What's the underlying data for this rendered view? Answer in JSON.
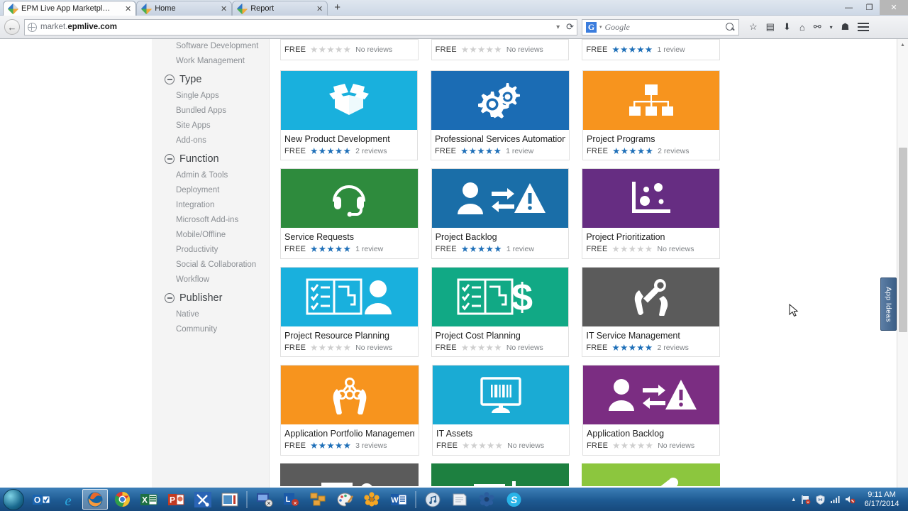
{
  "window": {
    "controls": {
      "minimize": "—",
      "maximize": "❐",
      "close": "✕"
    }
  },
  "browser": {
    "tabs": [
      {
        "title": "EPM Live App Marketplace",
        "close": "✕",
        "active": true
      },
      {
        "title": "Home",
        "close": "✕",
        "active": false
      },
      {
        "title": "Report",
        "close": "✕",
        "active": false
      }
    ],
    "new_tab_label": "+",
    "back_glyph": "←",
    "url_prefix": "market.",
    "url_bold": "epmlive.com",
    "reload_glyph": "⟳",
    "dropdown_glyph": "▾",
    "search_engine": "Google",
    "search_placeholder": "Google",
    "search_engine_letter": "G",
    "toolbar_icons": [
      "bookmark-star-icon",
      "reading-list-icon",
      "downloads-icon",
      "home-icon",
      "sync-icon",
      "chevron-down-icon",
      "firefox-hello-icon",
      "menu-icon"
    ]
  },
  "sidebar": {
    "orphan_items": [
      "Software Development",
      "Work Management"
    ],
    "groups": [
      {
        "title": "Type",
        "toggle": "collapse-icon",
        "items": [
          "Single Apps",
          "Bundled Apps",
          "Site Apps",
          "Add-ons"
        ]
      },
      {
        "title": "Function",
        "toggle": "collapse-icon",
        "items": [
          "Admin & Tools",
          "Deployment",
          "Integration",
          "Microsoft Add-ins",
          "Mobile/Offline",
          "Productivity",
          "Social & Collaboration",
          "Workflow"
        ]
      },
      {
        "title": "Publisher",
        "toggle": "collapse-icon",
        "items": [
          "Native",
          "Community"
        ]
      }
    ]
  },
  "marketplace": {
    "price_label": "FREE",
    "no_reviews_label": "No reviews",
    "cut_row": [
      {
        "price": "FREE",
        "rating": 0,
        "reviews": "No reviews"
      },
      {
        "price": "FREE",
        "rating": 0,
        "reviews": "No reviews"
      },
      {
        "price": "FREE",
        "rating": 5,
        "reviews": "1 review"
      }
    ],
    "apps": [
      {
        "name": "New Product Development",
        "price": "FREE",
        "rating": 5,
        "reviews": "2 reviews",
        "color": "#19b0dd",
        "icon": "open-box-icon"
      },
      {
        "name": "Professional Services Automation",
        "price": "FREE",
        "rating": 5,
        "reviews": "1 review",
        "color": "#1b6cb4",
        "icon": "gears-icon"
      },
      {
        "name": "Project Programs",
        "price": "FREE",
        "rating": 5,
        "reviews": "2 reviews",
        "color": "#f7941e",
        "icon": "org-chart-icon"
      },
      {
        "name": "Service Requests",
        "price": "FREE",
        "rating": 5,
        "reviews": "1 review",
        "color": "#2e8b3d",
        "icon": "headset-icon"
      },
      {
        "name": "Project Backlog",
        "price": "FREE",
        "rating": 5,
        "reviews": "1 review",
        "color": "#1a6ea8",
        "icon": "person-exchange-alert-icon"
      },
      {
        "name": "Project Prioritization",
        "price": "FREE",
        "rating": 0,
        "reviews": "No reviews",
        "color": "#662d82",
        "icon": "bubble-chart-icon"
      },
      {
        "name": "Project Resource Planning",
        "price": "FREE",
        "rating": 0,
        "reviews": "No reviews",
        "color": "#19b0dd",
        "icon": "checklist-gantt-person-icon"
      },
      {
        "name": "Project Cost Planning",
        "price": "FREE",
        "rating": 0,
        "reviews": "No reviews",
        "color": "#11a985",
        "icon": "checklist-gantt-dollar-icon"
      },
      {
        "name": "IT Service Management",
        "price": "FREE",
        "rating": 5,
        "reviews": "2 reviews",
        "color": "#5b5b5b",
        "icon": "hands-wrench-icon"
      },
      {
        "name": "Application Portfolio Management",
        "price": "FREE",
        "rating": 5,
        "reviews": "3 reviews",
        "color": "#f7941e",
        "icon": "hands-network-icon"
      },
      {
        "name": "IT Assets",
        "price": "FREE",
        "rating": 0,
        "reviews": "No reviews",
        "color": "#1aabd4",
        "icon": "monitor-barcode-icon"
      },
      {
        "name": "Application Backlog",
        "price": "FREE",
        "rating": 0,
        "reviews": "No reviews",
        "color": "#7b2d82",
        "icon": "person-exchange-alert-icon"
      }
    ],
    "partial_row_colors": [
      "#5b5b5b",
      "#1d8040",
      "#8cc63e"
    ],
    "app_ideas_tab": "App Ideas"
  },
  "taskbar": {
    "start": "start-orb",
    "items": [
      {
        "name": "outlook-icon",
        "active": false
      },
      {
        "name": "internet-explorer-icon",
        "active": false
      },
      {
        "name": "firefox-icon",
        "active": true
      },
      {
        "name": "chrome-icon",
        "active": false
      },
      {
        "name": "excel-icon",
        "active": false
      },
      {
        "name": "powerpoint-icon",
        "active": false
      },
      {
        "name": "tools-icon",
        "active": false
      },
      {
        "name": "media-player-icon",
        "active": false
      },
      {
        "name": "remote-desktop-icon",
        "active": false
      },
      {
        "name": "lync-icon",
        "active": false
      },
      {
        "name": "visio-icon",
        "active": false
      },
      {
        "name": "paint-icon",
        "active": false
      },
      {
        "name": "flower-app-icon",
        "active": false
      },
      {
        "name": "word-icon",
        "active": false
      },
      {
        "name": "itunes-icon",
        "active": false
      },
      {
        "name": "notepad-icon",
        "active": false
      },
      {
        "name": "flower-app2-icon",
        "active": false
      },
      {
        "name": "skype-icon",
        "active": false
      }
    ],
    "tray": {
      "show_hidden": "▴",
      "icons": [
        "flag-error-icon",
        "shield-icon",
        "network-icon",
        "volume-mute-icon"
      ],
      "time": "9:11 AM",
      "date": "6/17/2014"
    }
  }
}
